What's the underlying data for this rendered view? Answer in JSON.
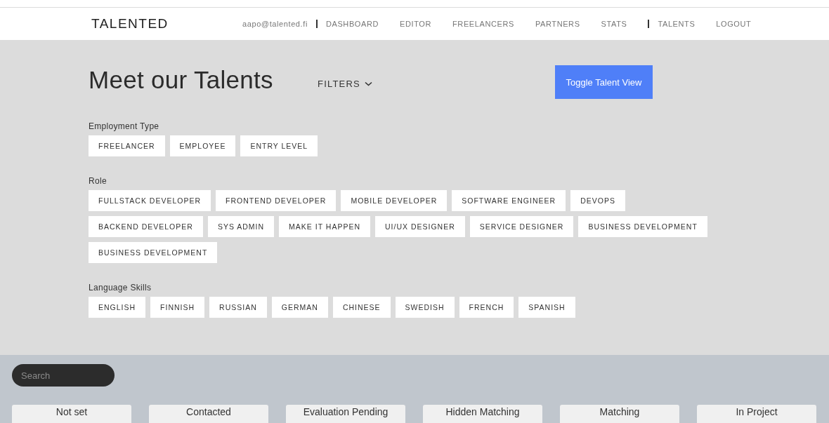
{
  "header": {
    "logo": "TALENTED",
    "user_email": "aapo@talented.fi",
    "nav": [
      "DASHBOARD",
      "EDITOR",
      "FREELANCERS",
      "PARTNERS",
      "STATS"
    ],
    "nav_after": [
      "TALENTS",
      "LOGOUT"
    ]
  },
  "title": "Meet our Talents",
  "filters_label": "FILTERS",
  "toggle_button": "Toggle Talent View",
  "filter_groups": [
    {
      "label": "Employment Type",
      "options": [
        "FREELANCER",
        "EMPLOYEE",
        "ENTRY LEVEL"
      ]
    },
    {
      "label": "Role",
      "options": [
        "FULLSTACK DEVELOPER",
        "FRONTEND DEVELOPER",
        "MOBILE DEVELOPER",
        "SOFTWARE ENGINEER",
        "DEVOPS",
        "BACKEND DEVELOPER",
        "SYS ADMIN",
        "MAKE IT HAPPEN",
        "UI/UX DESIGNER",
        "SERVICE DESIGNER",
        "BUSINESS DEVELOPMENT",
        "BUSINESS DEVELOPMENT"
      ]
    },
    {
      "label": "Language Skills",
      "options": [
        "ENGLISH",
        "FINNISH",
        "RUSSIAN",
        "GERMAN",
        "CHINESE",
        "SWEDISH",
        "FRENCH",
        "SPANISH"
      ]
    }
  ],
  "search": {
    "placeholder": "Search"
  },
  "status_columns": [
    "Not set",
    "Contacted",
    "Evaluation Pending",
    "Hidden Matching",
    "Matching",
    "In Project"
  ]
}
